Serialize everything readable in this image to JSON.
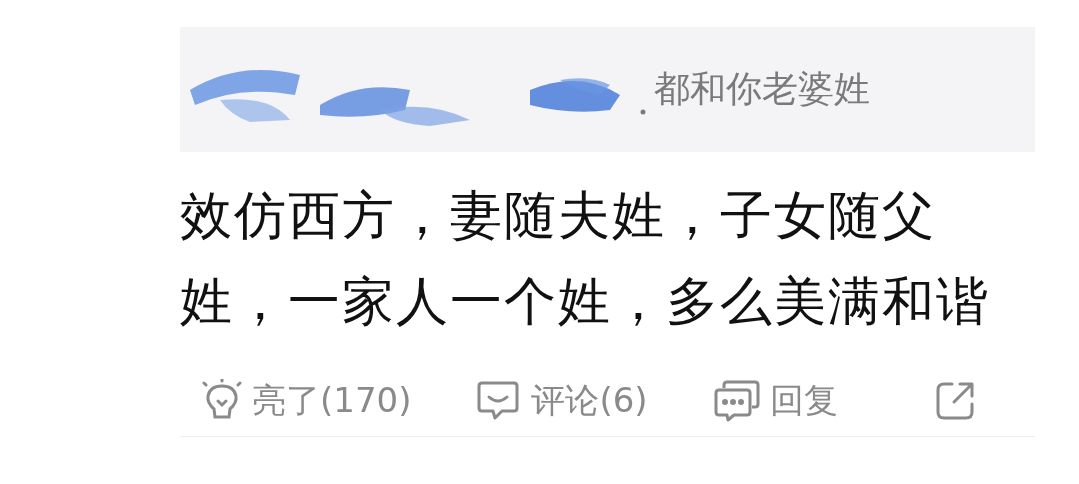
{
  "quote": {
    "text": "都和你老婆姓"
  },
  "comment": {
    "text": "效仿西方，妻随夫姓，子女随父姓，一家人一个姓，多么美满和谐"
  },
  "actions": [
    {
      "kind": "like",
      "label": "亮了(170)"
    },
    {
      "kind": "comment",
      "label": "评论(6)"
    },
    {
      "kind": "reply",
      "label": "回复"
    },
    {
      "kind": "share"
    }
  ]
}
